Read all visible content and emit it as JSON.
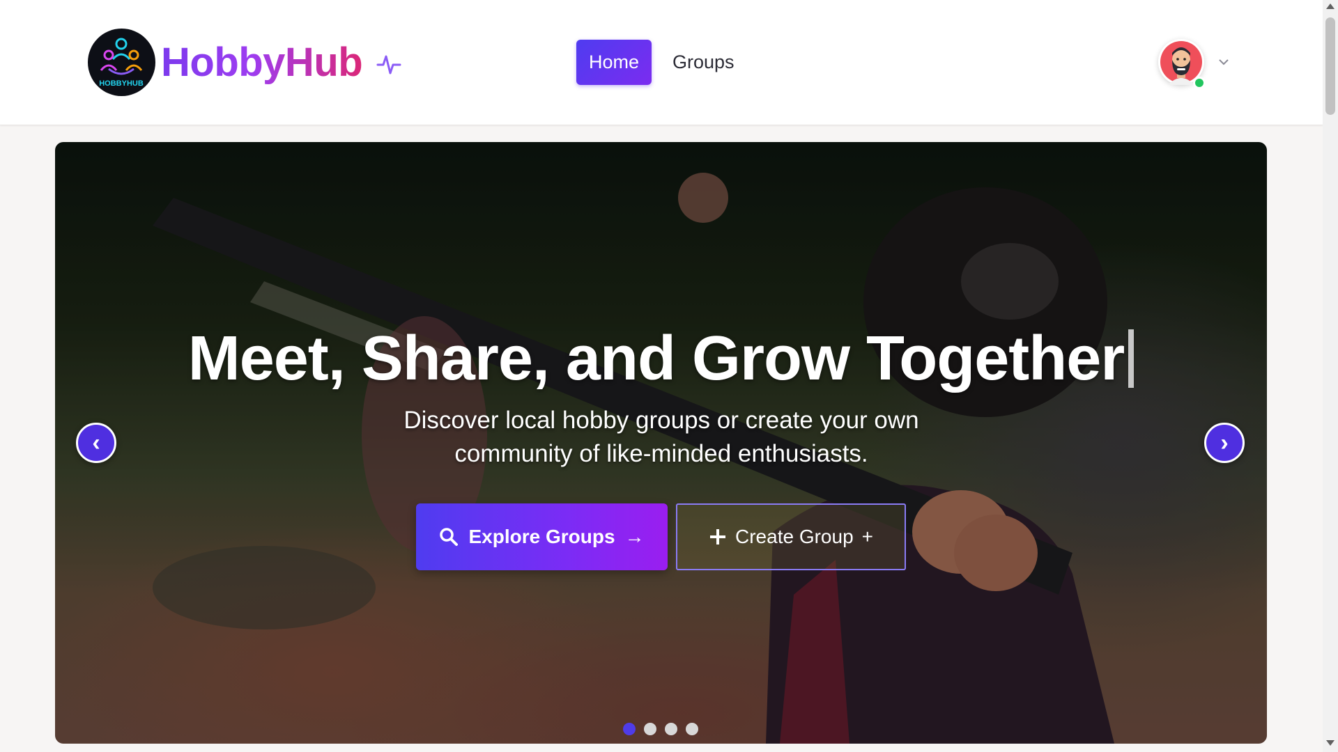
{
  "brand": {
    "name": "HobbyHub",
    "logo_text": "HOBBYHUB",
    "gradient": [
      "#7c3aed",
      "#db2777"
    ]
  },
  "nav": {
    "items": [
      {
        "label": "Home",
        "active": true
      },
      {
        "label": "Groups",
        "active": false
      }
    ],
    "accent": "#5b2ce8"
  },
  "user": {
    "avatar_icon": "bearded-man-avatar",
    "status": "online",
    "status_color": "#22c55e",
    "menu_icon": "chevron-down-icon"
  },
  "hero": {
    "title": "Meet, Share, and Grow Together",
    "subtitle": "Discover local hobby groups or create your own community of like-minded enthusiasts.",
    "primary_button": {
      "label": "Explore Groups",
      "icon": "search-icon",
      "suffix": "→"
    },
    "secondary_button": {
      "label": "Create Group",
      "icon": "plus-icon",
      "suffix": "+"
    },
    "prev_label": "‹",
    "next_label": "›",
    "slides": 4,
    "active_slide": 1
  }
}
